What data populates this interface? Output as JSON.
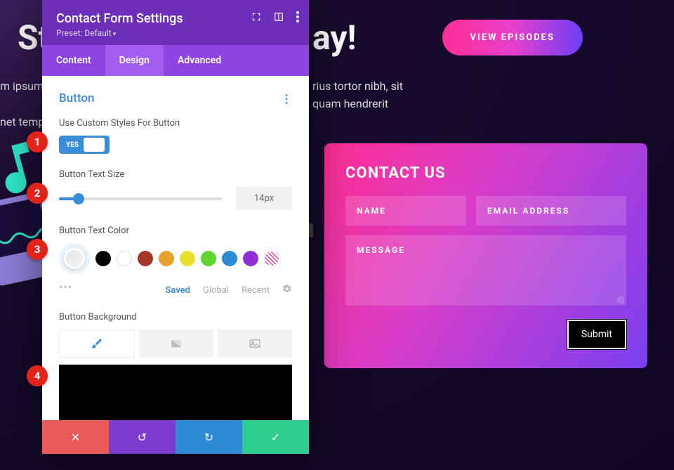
{
  "background": {
    "title_left": "St",
    "title_right": "ay!",
    "paragraph_l1_left": "m ipsum",
    "paragraph_l1_right": "rius tortor nibh, sit",
    "paragraph_l2_left": "net temp",
    "paragraph_l2_right": "quam hendrerit",
    "view_episodes": "VIEW EPISODES"
  },
  "contact": {
    "title": "CONTACT US",
    "name_placeholder": "NAME",
    "email_placeholder": "EMAIL ADDRESS",
    "message_placeholder": "MESSAGE",
    "submit": "Submit"
  },
  "modal": {
    "title": "Contact Form Settings",
    "preset": "Preset: Default",
    "tabs": {
      "content": "Content",
      "design": "Design",
      "advanced": "Advanced"
    },
    "section_title": "Button",
    "use_custom_label": "Use Custom Styles For Button",
    "toggle_yes": "YES",
    "text_size_label": "Button Text Size",
    "text_size_value": "14px",
    "text_color_label": "Button Text Color",
    "palette_tabs": {
      "saved": "Saved",
      "global": "Global",
      "recent": "Recent"
    },
    "background_label": "Button Background"
  },
  "annotations": {
    "b1": "1",
    "b2": "2",
    "b3": "3",
    "b4": "4"
  }
}
